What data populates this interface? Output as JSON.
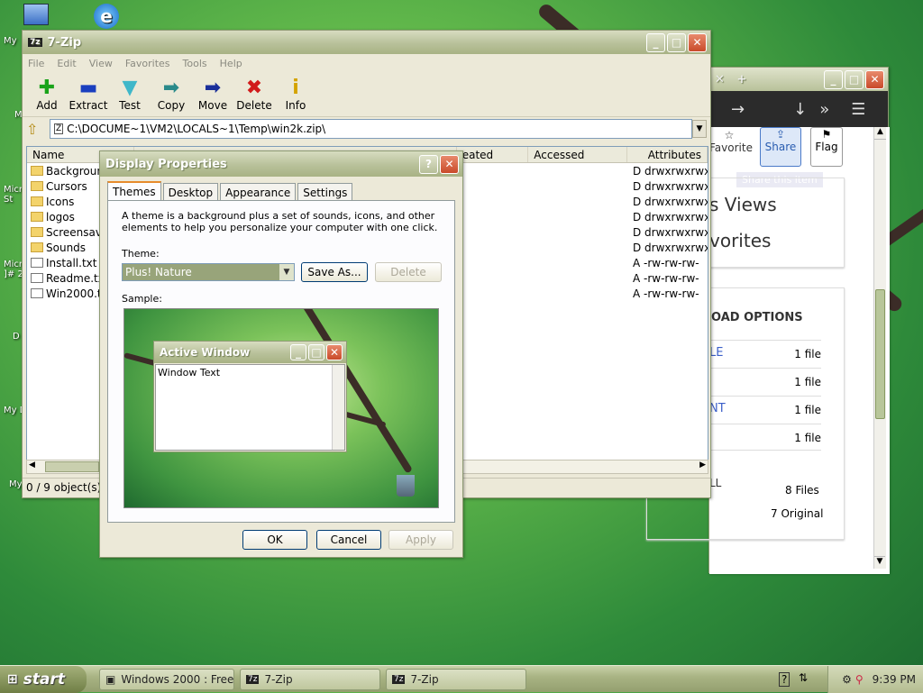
{
  "desktop": {
    "labels": [
      "My",
      "M",
      "Micro\nSt",
      "Micro\n]# 2",
      "D",
      "My D",
      "My"
    ]
  },
  "zip": {
    "title": "7-Zip",
    "menu": [
      "File",
      "Edit",
      "View",
      "Favorites",
      "Tools",
      "Help"
    ],
    "tools": [
      {
        "label": "Add",
        "icon": "add-icon",
        "glyph": "✚",
        "color": "#1aa31a"
      },
      {
        "label": "Extract",
        "icon": "extract-icon",
        "glyph": "▬",
        "color": "#1a3fbf"
      },
      {
        "label": "Test",
        "icon": "test-icon",
        "glyph": "▼",
        "color": "#3fb7c9"
      },
      {
        "label": "Copy",
        "icon": "copy-icon",
        "glyph": "➡",
        "color": "#2a8a8a"
      },
      {
        "label": "Move",
        "icon": "move-icon",
        "glyph": "➡",
        "color": "#1a2f9a"
      },
      {
        "label": "Delete",
        "icon": "delete-icon",
        "glyph": "✖",
        "color": "#d11a1a"
      },
      {
        "label": "Info",
        "icon": "info-icon",
        "glyph": "i",
        "color": "#d4a300"
      }
    ],
    "path": "C:\\DOCUME~1\\VM2\\LOCALS~1\\Temp\\win2k.zip\\",
    "columns": [
      "Name",
      "eated",
      "Accessed",
      "Attributes"
    ],
    "files": [
      {
        "name": "Backgroun",
        "type": "folder",
        "attr": "D drwxrwxrwx"
      },
      {
        "name": "Cursors",
        "type": "folder",
        "attr": "D drwxrwxrwx"
      },
      {
        "name": "Icons",
        "type": "folder",
        "attr": "D drwxrwxrwx"
      },
      {
        "name": "logos",
        "type": "folder",
        "attr": "D drwxrwxrwx"
      },
      {
        "name": "Screensav",
        "type": "folder",
        "attr": "D drwxrwxrwx"
      },
      {
        "name": "Sounds",
        "type": "folder",
        "attr": "D drwxrwxrwx"
      },
      {
        "name": "Install.txt",
        "type": "file",
        "attr": "A -rw-rw-rw-"
      },
      {
        "name": "Readme.tx",
        "type": "file",
        "attr": "A -rw-rw-rw-"
      },
      {
        "name": "Win2000.t",
        "type": "file",
        "attr": "A -rw-rw-rw-"
      }
    ],
    "status": "0 / 9 object(s)"
  },
  "browser": {
    "favorite_label": "Favorite",
    "share_label": "Share",
    "flag_label": "Flag",
    "tooltip": "Share this item",
    "views_text": "s Views",
    "favorites_text": "vorites",
    "download_heading": "OAD OPTIONS",
    "rows": [
      {
        "label": "LE",
        "count": "1 file"
      },
      {
        "label": "",
        "count": "1 file"
      },
      {
        "label": "NT",
        "count": "1 file"
      },
      {
        "label": "",
        "count": "1 file"
      }
    ],
    "all_label": "LL",
    "total_files": "8 Files",
    "original": "7 Original"
  },
  "dp": {
    "title": "Display Properties",
    "tabs": [
      "Themes",
      "Desktop",
      "Appearance",
      "Settings"
    ],
    "description": "A theme is a background plus a set of sounds, icons, and other elements to help you personalize your computer with one click.",
    "theme_label": "Theme:",
    "theme_value": "Plus! Nature",
    "save_as": "Save As...",
    "delete": "Delete",
    "sample_label": "Sample:",
    "active_window": "Active Window",
    "window_text": "Window Text",
    "ok": "OK",
    "cancel": "Cancel",
    "apply": "Apply"
  },
  "taskbar": {
    "start": "start",
    "tasks": [
      "Windows 2000 : Free...",
      "7-Zip",
      "7-Zip"
    ],
    "clock": "9:39 PM"
  }
}
